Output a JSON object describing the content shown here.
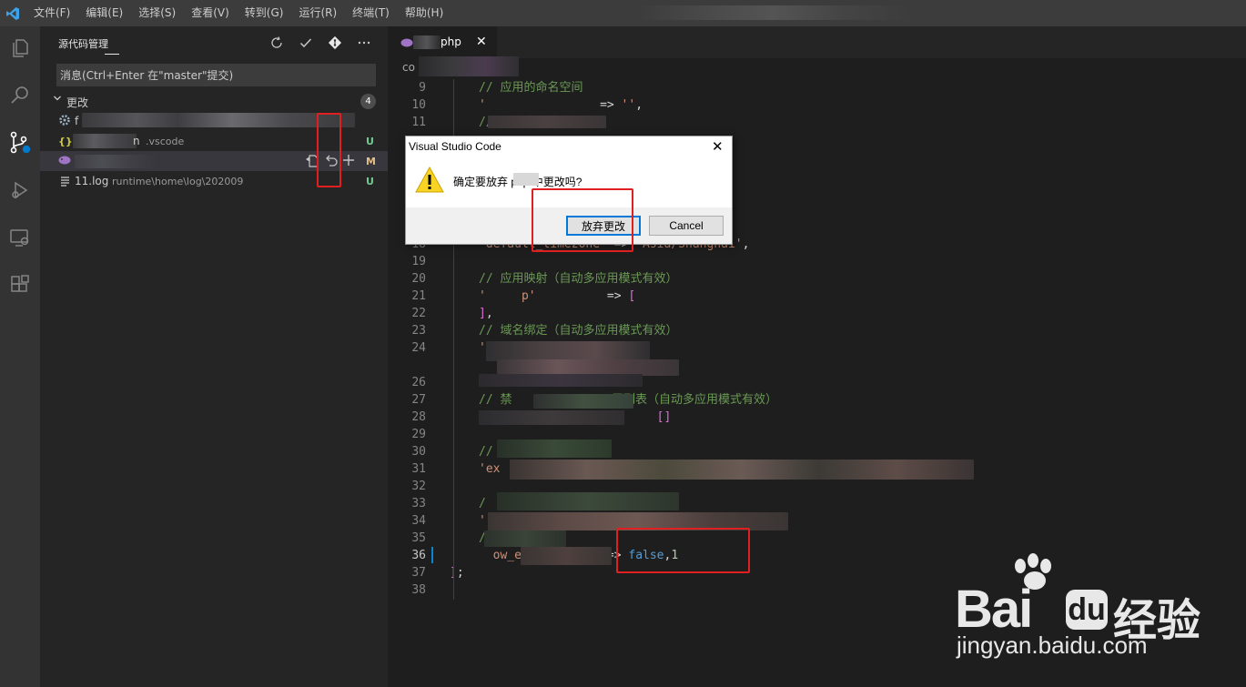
{
  "menubar": {
    "items": [
      "文件(F)",
      "编辑(E)",
      "选择(S)",
      "查看(V)",
      "转到(G)",
      "运行(R)",
      "终端(T)",
      "帮助(H)"
    ]
  },
  "activity_bar": {
    "icons": [
      "explorer-icon",
      "search-icon",
      "source-control-icon",
      "run-debug-icon",
      "remote-explorer-icon",
      "extensions-icon"
    ]
  },
  "sidebar": {
    "title": "源代码管理",
    "actions": [
      "refresh-icon",
      "check-icon",
      "git-icon",
      "more-icon"
    ],
    "commit_placeholder": "消息(Ctrl+Enter 在\"master\"提交)",
    "changes_label": "更改",
    "changes_count": "4",
    "files": [
      {
        "icon": "gear-icon",
        "name": "f",
        "path": "",
        "status": "",
        "status_color": "#73c991"
      },
      {
        "icon": "json-icon",
        "name": "n",
        "path": ".vscode",
        "status": "U",
        "status_color": "#73c991"
      },
      {
        "icon": "php-icon",
        "name": "",
        "path": "",
        "status": "M",
        "status_color": "#e2c08d"
      },
      {
        "icon": "file-lines-icon",
        "name": "11.log",
        "path": "runtime\\home\\log\\202009",
        "status": "U",
        "status_color": "#73c991"
      }
    ]
  },
  "editor": {
    "tab_label": "php",
    "breadcrumb": "co",
    "lines": [
      {
        "n": "9",
        "html": "<span class='cm'>// 应用的命名空间</span>"
      },
      {
        "n": "10",
        "html": "<span class='st'>'</span>                <span class='op'>=&gt;</span> <span class='st'>''</span><span class='op'>,</span>"
      },
      {
        "n": "11",
        "html": "<span class='cm'>// 是否启用路由</span>"
      },
      {
        "n": "18",
        "html": "<span class='st'>'default_timezone'</span> <span class='op'>=&gt;</span> <span class='st'>'Asia/Shanghai'</span><span class='op'>,</span>"
      },
      {
        "n": "19",
        "html": ""
      },
      {
        "n": "20",
        "html": "<span class='cm'>// 应用映射（自动多应用模式有效）</span>"
      },
      {
        "n": "21",
        "html": "<span class='st'>'     p'</span>          <span class='op'>=&gt;</span> <span class='br'>[</span>"
      },
      {
        "n": "22",
        "html": "<span class='br'>]</span><span class='op'>,</span>"
      },
      {
        "n": "23",
        "html": "<span class='cm'>// 域名绑定（自动多应用模式有效）</span>"
      },
      {
        "n": "24",
        "html": "<span class='st'>'</span>"
      },
      {
        "n": "",
        "html": "<span class='st'>                         e'</span><span class='op'>,</span>"
      },
      {
        "n": "26",
        "html": ""
      },
      {
        "n": "27",
        "html": "<span class='cm'>// 禁              用列表（自动多应用模式有效）</span>"
      },
      {
        "n": "28",
        "html": "                         <span class='br'>[]</span>"
      },
      {
        "n": "29",
        "html": ""
      },
      {
        "n": "30",
        "html": "<span class='cm'>// 异</span>"
      },
      {
        "n": "31",
        "html": "<span class='st'>'ex</span>                                                           <span class='st'>tpl'</span><span class='op'>,</span>"
      },
      {
        "n": "32",
        "html": ""
      },
      {
        "n": "33",
        "html": "<span class='cm'>/   错误显示</span>"
      },
      {
        "n": "34",
        "html": "<span class='st'>'</span>                <span class='op'>&gt;</span>                  <span class='op'>,</span>"
      },
      {
        "n": "35",
        "html": "<span class='cm'>/       信息</span>"
      },
      {
        "n": "36",
        "html": "<span class='st'>  ow_e</span>            <span class='op'>=&gt;</span> <span class='kw'>false</span><span class='op'>,</span><span class='num'>1</span>"
      },
      {
        "n": "37",
        "html": "<span class='br' style='margin-left:-32px'>]</span><span class='op'>;</span>"
      },
      {
        "n": "38",
        "html": ""
      }
    ]
  },
  "dialog": {
    "title": "Visual Studio Code",
    "message": "确定要放弃       php 中更改吗?",
    "discard_label": "放弃更改",
    "cancel_label": "Cancel"
  },
  "watermark": {
    "brand": "Bai",
    "brand_suffix": "经验",
    "url": "jingyan.baidu.com"
  },
  "colors": {
    "accent": "#007acc",
    "annotation_red": "#e02020"
  }
}
